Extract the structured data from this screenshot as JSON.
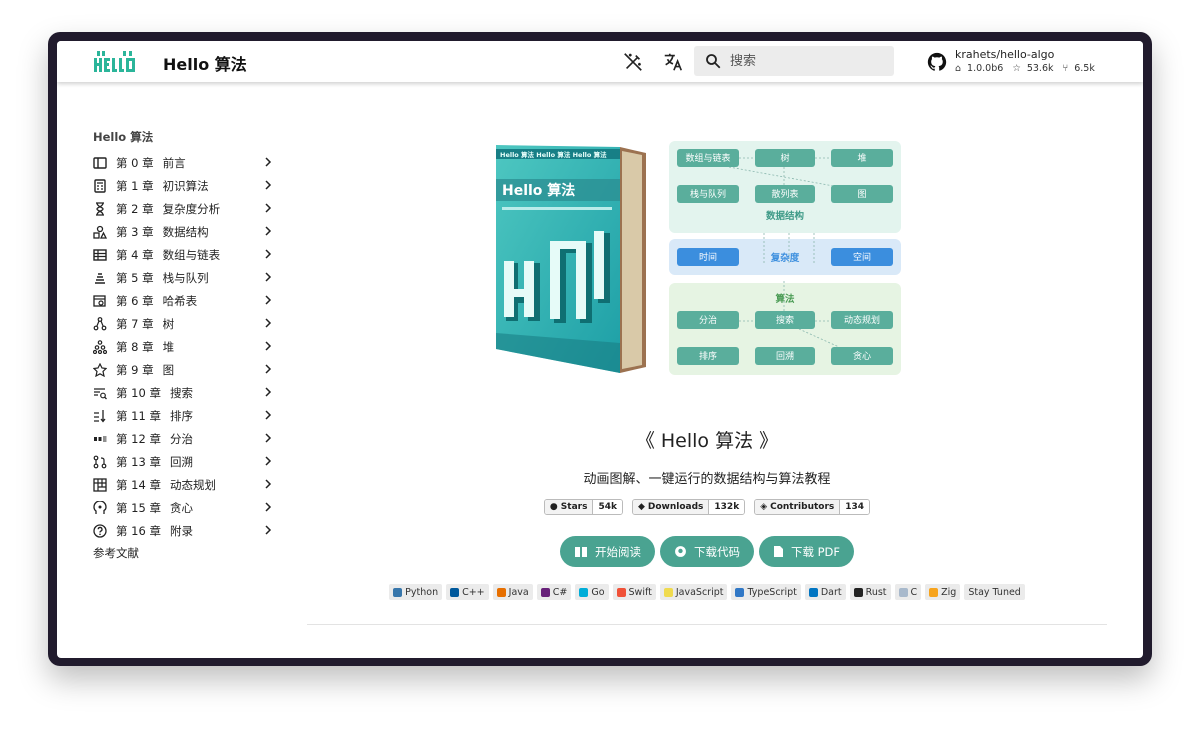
{
  "header": {
    "title": "Hello 算法",
    "search_placeholder": "搜索",
    "repo": {
      "name": "krahets/hello-algo",
      "version": "1.0.0b6",
      "stars": "53.6k",
      "forks": "6.5k"
    }
  },
  "sidebar": {
    "heading": "Hello 算法",
    "items": [
      {
        "num": "第 0 章",
        "label": "前言",
        "icon": "book-open-icon"
      },
      {
        "num": "第 1 章",
        "label": "初识算法",
        "icon": "calculator-icon"
      },
      {
        "num": "第 2 章",
        "label": "复杂度分析",
        "icon": "hourglass-icon"
      },
      {
        "num": "第 3 章",
        "label": "数据结构",
        "icon": "shapes-icon"
      },
      {
        "num": "第 4 章",
        "label": "数组与链表",
        "icon": "table-icon"
      },
      {
        "num": "第 5 章",
        "label": "栈与队列",
        "icon": "stack-icon"
      },
      {
        "num": "第 6 章",
        "label": "哈希表",
        "icon": "table-search-icon"
      },
      {
        "num": "第 7 章",
        "label": "树",
        "icon": "tree-icon"
      },
      {
        "num": "第 8 章",
        "label": "堆",
        "icon": "pyramid-icon"
      },
      {
        "num": "第 9 章",
        "label": "图",
        "icon": "graph-icon"
      },
      {
        "num": "第 10 章",
        "label": "搜索",
        "icon": "text-search-icon"
      },
      {
        "num": "第 11 章",
        "label": "排序",
        "icon": "sort-icon"
      },
      {
        "num": "第 12 章",
        "label": "分治",
        "icon": "split-icon"
      },
      {
        "num": "第 13 章",
        "label": "回溯",
        "icon": "routes-icon"
      },
      {
        "num": "第 14 章",
        "label": "动态规划",
        "icon": "grid-icon"
      },
      {
        "num": "第 15 章",
        "label": "贪心",
        "icon": "head-icon"
      },
      {
        "num": "第 16 章",
        "label": "附录",
        "icon": "help-icon"
      }
    ],
    "footer": "参考文献"
  },
  "book": {
    "cover_title": "Hello 算法",
    "brand_strip": "Hello 算法 Hello 算法 Hello 算法"
  },
  "diagram": {
    "ds_row1": [
      "数组与链表",
      "树",
      "堆"
    ],
    "ds_row2": [
      "栈与队列",
      "散列表",
      "图"
    ],
    "ds_label": "数据结构",
    "complexity": [
      "时间",
      "复杂度",
      "空间"
    ],
    "algo_label": "算法",
    "algo_row1": [
      "分治",
      "搜索",
      "动态规划"
    ],
    "algo_row2": [
      "排序",
      "回溯",
      "贪心"
    ]
  },
  "main": {
    "title": "《 Hello 算法 》",
    "subtitle": "动画图解、一键运行的数据结构与算法教程",
    "badges": [
      {
        "key": "Stars",
        "value": "54k"
      },
      {
        "key": "Downloads",
        "value": "132k"
      },
      {
        "key": "Contributors",
        "value": "134"
      }
    ],
    "buttons": {
      "read": "开始阅读",
      "code": "下载代码",
      "pdf": "下载 PDF"
    },
    "languages": [
      {
        "name": "Python",
        "color": "#3776ab"
      },
      {
        "name": "C++",
        "color": "#00599c"
      },
      {
        "name": "Java",
        "color": "#e76f00"
      },
      {
        "name": "C#",
        "color": "#68217a"
      },
      {
        "name": "Go",
        "color": "#00add8"
      },
      {
        "name": "Swift",
        "color": "#f05138"
      },
      {
        "name": "JavaScript",
        "color": "#f0db4f"
      },
      {
        "name": "TypeScript",
        "color": "#3178c6"
      },
      {
        "name": "Dart",
        "color": "#0175c2"
      },
      {
        "name": "Rust",
        "color": "#222222"
      },
      {
        "name": "C",
        "color": "#a8b9cc"
      },
      {
        "name": "Zig",
        "color": "#f7a41d"
      },
      {
        "name": "Stay Tuned",
        "color": ""
      }
    ]
  },
  "colors": {
    "accent": "#4aa391",
    "teal": "#2fb5a8",
    "ds_bg": "#e6f5ef",
    "complexity_bg": "#dbeaf8",
    "blue": "#3b8ede"
  }
}
